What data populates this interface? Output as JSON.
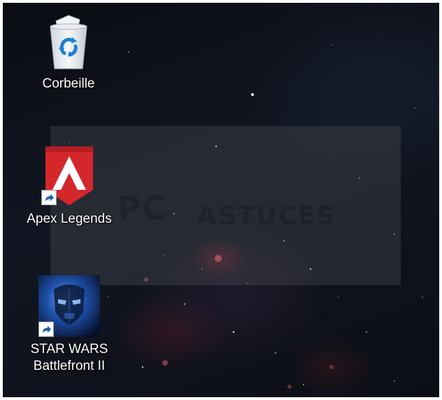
{
  "desktop": {
    "icons": [
      {
        "label": "Corbeille",
        "icon": "recycle-bin-icon",
        "shortcut": false
      },
      {
        "label": "Apex Legends",
        "icon": "apex-legends-icon",
        "shortcut": true
      },
      {
        "label": "STAR WARS\nBattlefront II",
        "icon": "star-wars-battlefront-icon",
        "shortcut": true
      }
    ]
  },
  "watermark": {
    "logo": "PC ASTUCES",
    "color": "#787878"
  },
  "colors": {
    "apex_red": "#d4272c",
    "bin_blue": "#1a7fd4",
    "starwars_blue": "#1f4fa8"
  }
}
